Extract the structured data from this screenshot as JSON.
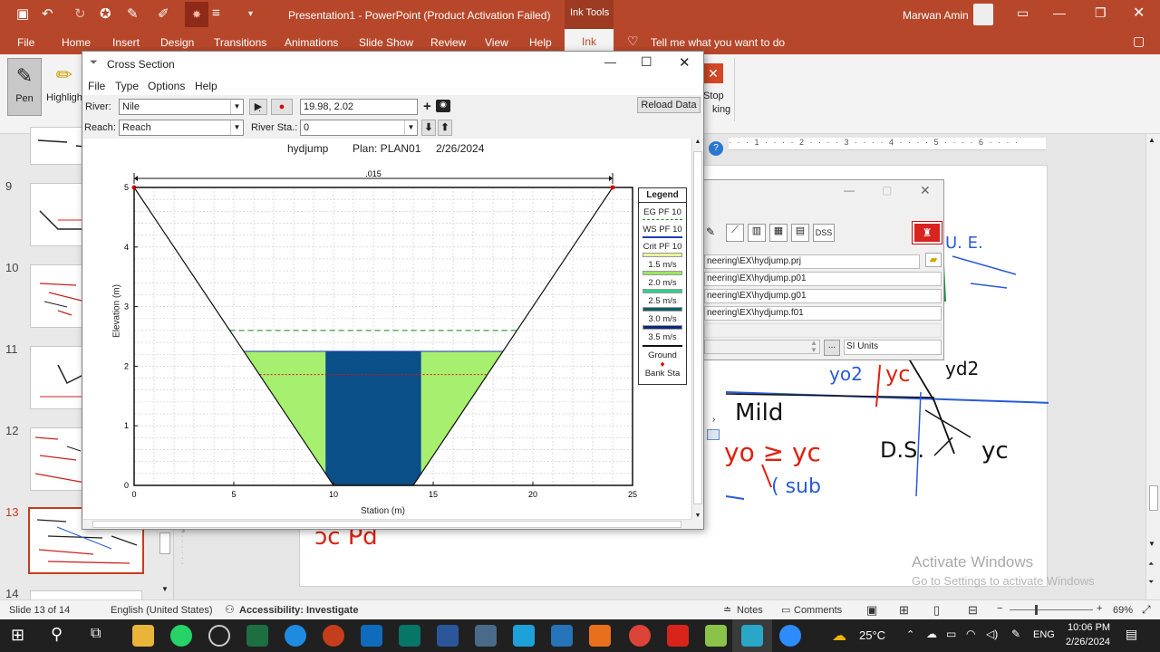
{
  "app": {
    "window_title": "Presentation1  -  PowerPoint (Product Activation Failed)",
    "contextual_tab_group": "Ink Tools",
    "user_name": "Marwan Amin",
    "tell_me": "Tell me what you want to do"
  },
  "ribbon_tabs": [
    "File",
    "Home",
    "Insert",
    "Design",
    "Transitions",
    "Animations",
    "Slide Show",
    "Review",
    "View",
    "Help",
    "Ink"
  ],
  "active_tab": "Ink",
  "ribbon": {
    "pen_label": "Pen",
    "highlighter_label": "Highligh",
    "stop_label_1": "Stop",
    "stop_label_2": "king"
  },
  "slides": {
    "numbers": [
      "9",
      "10",
      "11",
      "12",
      "13",
      "14"
    ],
    "selected": "13"
  },
  "status_bar": {
    "slide_of": "Slide 13 of 14",
    "language": "English (United States)",
    "accessibility": "Accessibility: Investigate",
    "notes": "Notes",
    "comments": "Comments",
    "zoom": "69%"
  },
  "watermark": {
    "line1": "Activate Windows",
    "line2": "Go to Settings to activate Windows"
  },
  "slide_ink": {
    "mild": "Mild",
    "yo_dc": "yo ≥ yc",
    "csub": "( sub",
    "ds": "D.S.",
    "yc": "yc",
    "yo2": "yo2",
    "yc2": "yc",
    "ue": "U. E.",
    "yd2": "yd2"
  },
  "hecras_main": {
    "paths": [
      "neering\\EX\\hydjump.prj",
      "neering\\EX\\hydjump.p01",
      "neering\\EX\\hydjump.g01",
      "neering\\EX\\hydjump.f01"
    ],
    "units": "SI Units",
    "dss_label": "DSS",
    "browse_label": "..."
  },
  "cross_section": {
    "window_title": "Cross Section",
    "menu": [
      "File",
      "Type",
      "Options",
      "Help"
    ],
    "river_label": "River:",
    "river_value": "Nile",
    "reach_label": "Reach:",
    "reach_value": "Reach",
    "river_sta_label": "River Sta.:",
    "river_sta_value": "0",
    "coordinate_readout": "19.98, 2.02",
    "reload_label": "Reload Data",
    "plot_header": {
      "project": "hydjump",
      "plan": "Plan: PLAN01",
      "date": "2/26/2024"
    }
  },
  "chart_data": {
    "type": "area",
    "title": "",
    "xlabel": "Station (m)",
    "ylabel": "Elevation (m)",
    "xlim": [
      0,
      25
    ],
    "ylim": [
      0,
      5
    ],
    "xticks": [
      "0",
      "5",
      "10",
      "15",
      "20",
      "25"
    ],
    "yticks": [
      "0",
      "1",
      "2",
      "3",
      "4",
      "5"
    ],
    "grid": true,
    "manning_label": ".015",
    "ground": {
      "x": [
        0,
        10,
        14,
        24
      ],
      "y": [
        5,
        0,
        0,
        5
      ]
    },
    "bank_stations": {
      "x": [
        0,
        24
      ],
      "y": [
        5,
        5
      ]
    },
    "eg_elevation": 2.6,
    "ws_elevation": 2.25,
    "crit_elevation": 1.86,
    "velocity_zones": [
      {
        "x0": 5.5,
        "x1": 9.6,
        "class": "1.5 m/s"
      },
      {
        "x0": 9.6,
        "x1": 14.4,
        "class": "3.0 m/s"
      },
      {
        "x0": 14.4,
        "x1": 18.5,
        "class": "1.5 m/s"
      }
    ],
    "legend": {
      "title": "Legend",
      "placement": "right",
      "entries": [
        "EG PF 10",
        "WS PF 10",
        "Crit PF 10",
        "1.5 m/s",
        "2.0 m/s",
        "2.5 m/s",
        "3.0 m/s",
        "3.5 m/s",
        "Ground",
        "Bank Sta"
      ],
      "colors": {
        "1.5 m/s": "#ecf59a",
        "2.0 m/s": "#9be85f",
        "2.5 m/s": "#2bd48a",
        "3.0 m/s": "#0f5e63",
        "3.5 m/s": "#0b2a78",
        "flow_light": "#a7ef6f",
        "flow_dark": "#0a4f88"
      }
    }
  },
  "taskbar": {
    "temperature": "25°C",
    "language": "ENG",
    "time": "10:06 PM",
    "date": "2/26/2024"
  }
}
